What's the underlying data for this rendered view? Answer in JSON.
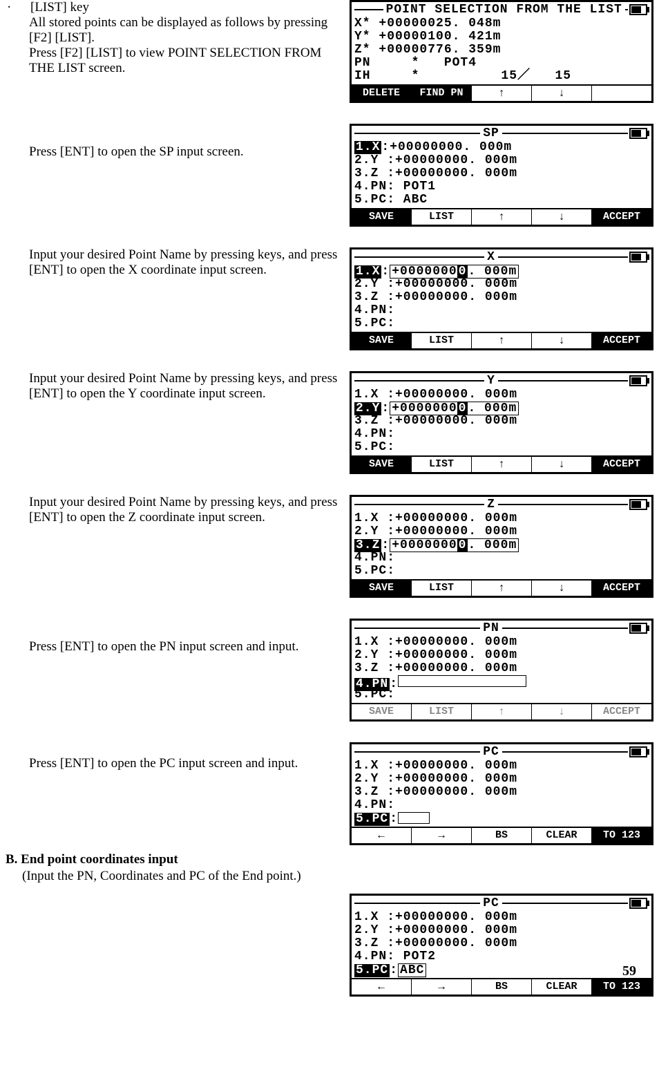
{
  "bullet": "·",
  "s1": {
    "line1": "[LIST] key",
    "line2": "All stored points can be displayed as follows by pressing [F2] [LIST].",
    "line3": "Press [F2] [LIST] to view POINT SELECTION FROM THE LIST screen.",
    "lcd": {
      "title": "POINT SELECTION FROM THE LIST",
      "r1": "X* +00000025. 048m",
      "r2": "Y* +00000100. 421m",
      "r3": "Z* +00000776. 359m",
      "r4": "PN     *   POT4",
      "r5": "IH     *          15／   15",
      "sk1": "DELETE",
      "sk2": "FIND PN",
      "sk3": "↑",
      "sk4": "↓",
      "sk5": ""
    }
  },
  "s2": {
    "text": "Press [ENT] to open the SP input screen.",
    "lcd": {
      "title": "SP",
      "r1a": "1.X",
      "r1b": ":+00000000. 000m",
      "r2": "2.Y :+00000000. 000m",
      "r3": "3.Z :+00000000. 000m",
      "r4": "4.PN: POT1",
      "r5": "5.PC: ABC",
      "sk1": "SAVE",
      "sk2": "LIST",
      "sk3": "↑",
      "sk4": "↓",
      "sk5": "ACCEPT"
    }
  },
  "s3": {
    "text": "Input your desired Point Name by pressing keys, and press [ENT] to open the X coordinate input screen.",
    "lcd": {
      "title": "X",
      "r1a": "1.X",
      "r1b": ":",
      "r1c_pre": "+0000000",
      "r1c_hl": "0",
      "r1c_post": ". 000m",
      "r2": "2.Y :+00000000. 000m",
      "r3": "3.Z :+00000000. 000m",
      "r4": "4.PN:",
      "r5": "5.PC:",
      "sk1": "SAVE",
      "sk2": "LIST",
      "sk3": "↑",
      "sk4": "↓",
      "sk5": "ACCEPT"
    }
  },
  "s4": {
    "text": "Input your desired Point Name by pressing keys, and press [ENT] to open the Y coordinate input screen.",
    "lcd": {
      "title": "Y",
      "r1": "1.X :+00000000. 000m",
      "r2a": "2.Y",
      "r2b": ":",
      "r2c_pre": "+0000000",
      "r2c_hl": "0",
      "r2c_post": ". 000m",
      "r3": "3.Z :+00000000. 000m",
      "r4": "4.PN:",
      "r5": "5.PC:",
      "sk1": "SAVE",
      "sk2": "LIST",
      "sk3": "↑",
      "sk4": "↓",
      "sk5": "ACCEPT"
    }
  },
  "s5": {
    "text": "Input your desired Point Name by pressing keys, and press [ENT] to open the Z coordinate input screen.",
    "lcd": {
      "title": "Z",
      "r1": "1.X :+00000000. 000m",
      "r2": "2.Y :+00000000. 000m",
      "r3a": "3.Z",
      "r3b": ":",
      "r3c_pre": "+0000000",
      "r3c_hl": "0",
      "r3c_post": ". 000m",
      "r4": "4.PN:",
      "r5": "5.PC:",
      "sk1": "SAVE",
      "sk2": "LIST",
      "sk3": "↑",
      "sk4": "↓",
      "sk5": "ACCEPT"
    }
  },
  "s6": {
    "text": "Press [ENT] to open the PN input screen and input.",
    "lcd": {
      "title": "PN",
      "r1": "1.X :+00000000. 000m",
      "r2": "2.Y :+00000000. 000m",
      "r3": "3.Z :+00000000. 000m",
      "r4a": "4.PN",
      "r4b": ":",
      "r5": "5.PC:",
      "sk1": "SAVE",
      "sk2": "LIST",
      "sk3": "↑",
      "sk4": "↓",
      "sk5": "ACCEPT"
    }
  },
  "s7": {
    "text": "Press [ENT] to open the PC input screen and input.",
    "lcd": {
      "title": "PC",
      "r1": "1.X :+00000000. 000m",
      "r2": "2.Y :+00000000. 000m",
      "r3": "3.Z :+00000000. 000m",
      "r4": "4.PN:",
      "r5a": "5.PC",
      "r5b": ":",
      "r5c": " ",
      "sk1": "←",
      "sk2": "→",
      "sk3": "BS",
      "sk4": "CLEAR",
      "sk5": "TO 123"
    }
  },
  "sectionB": {
    "heading": "B.  End point coordinates input",
    "sub": "(Input the PN, Coordinates and PC of the End point.)"
  },
  "s8": {
    "lcd": {
      "title": "PC",
      "r1": "1.X :+00000000. 000m",
      "r2": "2.Y :+00000000. 000m",
      "r3": "3.Z :+00000000. 000m",
      "r4": "4.PN: POT2",
      "r5a": "5.PC",
      "r5b": ":",
      "r5c": "ABC",
      "sk1": "←",
      "sk2": "→",
      "sk3": "BS",
      "sk4": "CLEAR",
      "sk5": "TO 123"
    }
  },
  "pagenum": "59"
}
